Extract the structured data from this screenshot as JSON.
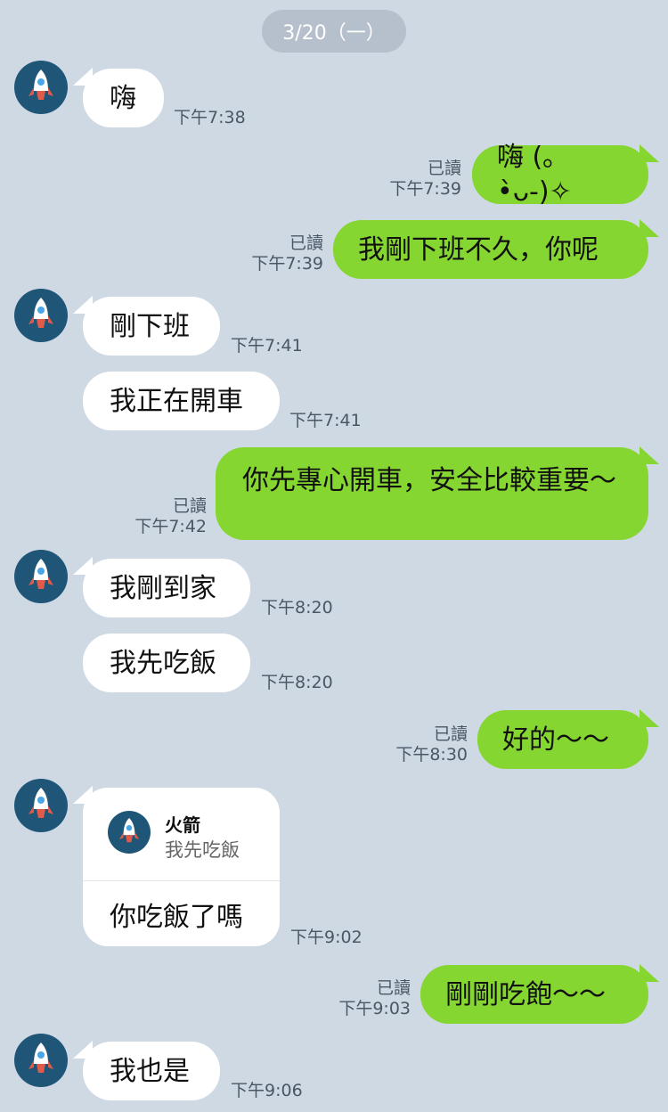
{
  "date": "3/20（一）",
  "read_label": "已讀",
  "messages": [
    {
      "text": "嗨",
      "time": "下午7:38"
    },
    {
      "text": "嗨 (｡•̀ᴗ-)✧",
      "time": "下午7:39"
    },
    {
      "text": "我剛下班不久，你呢",
      "time": "下午7:39"
    },
    {
      "text": "剛下班",
      "time": "下午7:41"
    },
    {
      "text": "我正在開車",
      "time": "下午7:41"
    },
    {
      "text": "你先專心開車，安全比較重要～",
      "time": "下午7:42"
    },
    {
      "text": "我剛到家",
      "time": "下午8:20"
    },
    {
      "text": "我先吃飯",
      "time": "下午8:20"
    },
    {
      "text": "好的～～",
      "time": "下午8:30"
    },
    {
      "text": "你吃飯了嗎",
      "time": "下午9:02",
      "reply_to": {
        "name": "火箭",
        "text": "我先吃飯"
      }
    },
    {
      "text": "剛剛吃飽～～",
      "time": "下午9:03"
    },
    {
      "text": "我也是",
      "time": "下午9:06"
    }
  ],
  "avatar_icon": "rocket-icon",
  "colors": {
    "background": "#cfd9e4",
    "outgoing": "#86d632",
    "incoming": "#ffffff",
    "avatar_bg": "#1f5577"
  }
}
